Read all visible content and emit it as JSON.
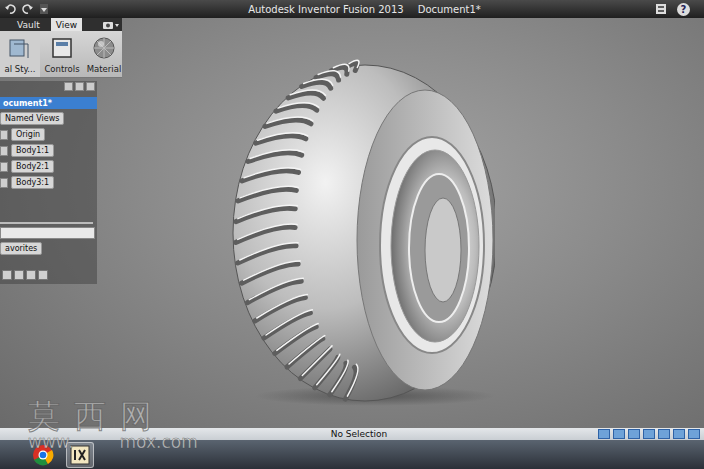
{
  "window": {
    "title": "Autodesk Inventor Fusion 2013",
    "document": "Document1*",
    "help": "?"
  },
  "ribbon_tabs": [
    {
      "label": "Vault",
      "selected": false
    },
    {
      "label": "View",
      "selected": true
    }
  ],
  "ribbon_buttons": [
    {
      "label": "al Sty..."
    },
    {
      "label": "Controls"
    },
    {
      "label": "Material"
    }
  ],
  "browser": {
    "document": {
      "label": "ocument1*",
      "selected": true
    },
    "named_views": "Named Views",
    "items": [
      {
        "label": "Origin"
      },
      {
        "label": "Body1:1"
      },
      {
        "label": "Body2:1"
      },
      {
        "label": "Body3:1"
      }
    ],
    "favorites": "avorites"
  },
  "status_bar": "No Selection",
  "watermark": {
    "title": "莫西网",
    "site_prefix": "www.",
    "site": "mox.com"
  }
}
